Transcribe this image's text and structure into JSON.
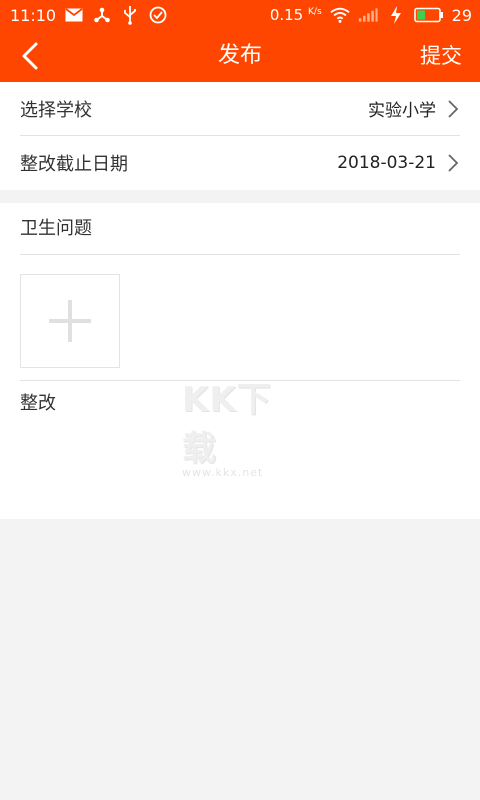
{
  "status_bar": {
    "time": "11:10",
    "speed_value": "0.15",
    "speed_unit": "K/s",
    "battery": "29"
  },
  "nav": {
    "title": "发布",
    "submit_label": "提交"
  },
  "form": {
    "school_label": "选择学校",
    "school_value": "实验小学",
    "deadline_label": "整改截止日期",
    "deadline_value": "2018-03-21"
  },
  "sections": {
    "hygiene_title": "卫生问题",
    "rectify_title": "整改"
  },
  "watermark": {
    "logo": "KK下载",
    "url": "www.kkx.net"
  },
  "colors": {
    "brand": "#ff4600",
    "background": "#f3f3f3"
  }
}
